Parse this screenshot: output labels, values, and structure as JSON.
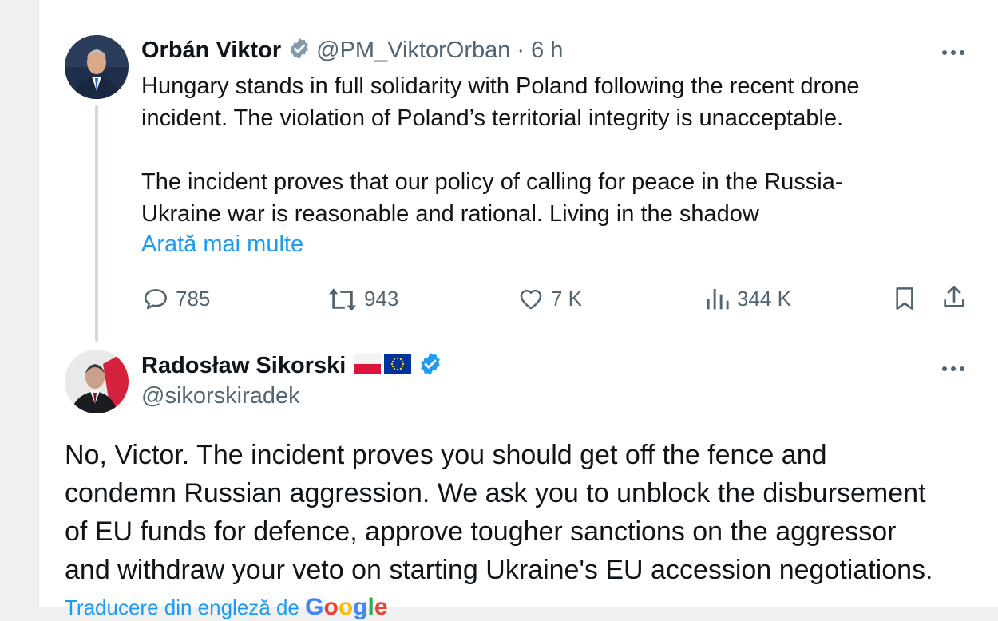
{
  "colors": {
    "accent": "#1d9bf0",
    "verified": "#1d9bf0",
    "muted": "#536471",
    "text": "#0f1419"
  },
  "tweet1": {
    "author_name": "Orbán Viktor",
    "handle": "@PM_ViktorOrban",
    "separator": "·",
    "time": "6 h",
    "more_icon": "more-horizontal-icon",
    "text_lines": [
      "Hungary stands in full solidarity with Poland following the recent drone",
      "incident. The violation of Poland’s territorial integrity is unacceptable.",
      "",
      "The incident proves that our policy of calling for peace in the Russia-",
      "Ukraine war is reasonable and rational. Living in the shadow"
    ],
    "show_more": "Arată mai multe",
    "actions": {
      "replies": "785",
      "reposts": "943",
      "likes": "7 K",
      "views": "344 K"
    }
  },
  "tweet2": {
    "author_name": "Radosław Sikorski",
    "flags": [
      "poland-flag-icon",
      "eu-flag-icon"
    ],
    "handle": "@sikorskiradek",
    "more_icon": "more-horizontal-icon",
    "text_lines": [
      "No, Victor.  The incident proves you should get off the fence and",
      "condemn Russian aggression.  We ask you to unblock the disbursement",
      "of EU funds for defence, approve tougher sanctions on the aggressor",
      "and withdraw your veto on starting Ukraine's EU accession negotiations."
    ],
    "translate_label": "Traducere din engleză de",
    "translate_brand": "Google"
  }
}
